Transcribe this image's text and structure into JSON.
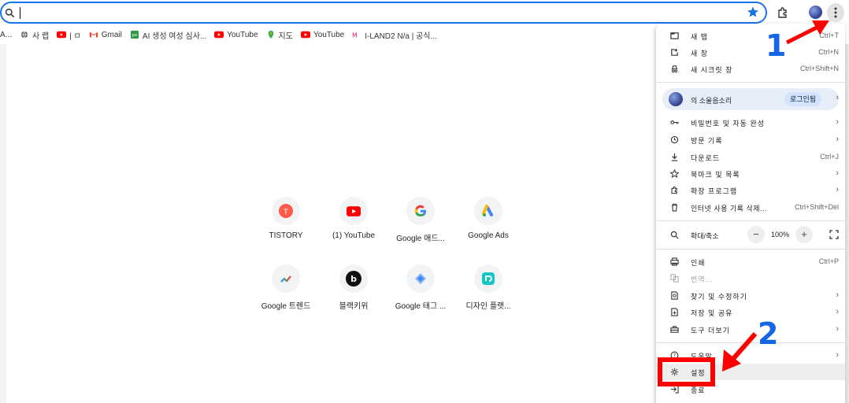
{
  "omnibox": {
    "value": "",
    "placeholder": ""
  },
  "bookmarks": [
    {
      "label": "A...",
      "icon": "none"
    },
    {
      "label": "사 랩",
      "icon": "globe-icon"
    },
    {
      "label": "| ㅁ",
      "icon": "youtube-icon"
    },
    {
      "label": "Gmail",
      "icon": "gmail-icon"
    },
    {
      "label": "AI 생성 여성 심사...",
      "icon": "px-icon"
    },
    {
      "label": "YouTube",
      "icon": "youtube-icon"
    },
    {
      "label": "지도",
      "icon": "maps-icon"
    },
    {
      "label": "YouTube",
      "icon": "youtube-icon"
    },
    {
      "label": "I-LAND2 N/a | 공식...",
      "icon": "mnet-icon"
    }
  ],
  "shortcuts": [
    {
      "label": "TISTORY",
      "icon": "tistory-icon"
    },
    {
      "label": "(1) YouTube",
      "icon": "youtube-icon"
    },
    {
      "label": "Google 애드...",
      "icon": "google-icon"
    },
    {
      "label": "Google Ads",
      "icon": "google-ads-icon"
    },
    {
      "label": "Google 트렌드",
      "icon": "google-trends-icon"
    },
    {
      "label": "블랙키위",
      "icon": "blackkiwi-icon"
    },
    {
      "label": "Google 태그 ...",
      "icon": "tag-manager-icon"
    },
    {
      "label": "디자인 플랫...",
      "icon": "design-platform-icon"
    }
  ],
  "menu": {
    "new_tab": {
      "label": "새 탭",
      "shortcut": "Ctrl+T"
    },
    "new_window": {
      "label": "새 창",
      "shortcut": "Ctrl+N"
    },
    "incognito": {
      "label": "새 시크릿 창",
      "shortcut": "Ctrl+Shift+N"
    },
    "profile": {
      "name": "의 소울음소리",
      "login": "로그인됨"
    },
    "passwords": {
      "label": "비밀번호 및 자동 완성"
    },
    "history": {
      "label": "방문 기록"
    },
    "downloads": {
      "label": "다운로드",
      "shortcut": "Ctrl+J"
    },
    "bookmarks": {
      "label": "북마크 및 목록"
    },
    "extensions": {
      "label": "확장 프로그램"
    },
    "clear_data": {
      "label": "인터넷 사용 기록 삭제...",
      "shortcut": "Ctrl+Shift+Del"
    },
    "zoom": {
      "label": "확대/축소",
      "value": "100%",
      "minus": "−",
      "plus": "+"
    },
    "print": {
      "label": "인쇄",
      "shortcut": "Ctrl+P"
    },
    "translate": {
      "label": "번역..."
    },
    "find_edit": {
      "label": "찾기 및 수정하기"
    },
    "save_share": {
      "label": "저장 및 공유"
    },
    "more_tools": {
      "label": "도구 더보기"
    },
    "help": {
      "label": "도움말"
    },
    "settings": {
      "label": "설정"
    },
    "exit": {
      "label": "종료"
    }
  },
  "annotations": {
    "step1": "1",
    "step2": "2"
  },
  "colors": {
    "accent": "#1a73e8",
    "annotation_red": "#ff0000",
    "annotation_blue": "#1565e8"
  }
}
